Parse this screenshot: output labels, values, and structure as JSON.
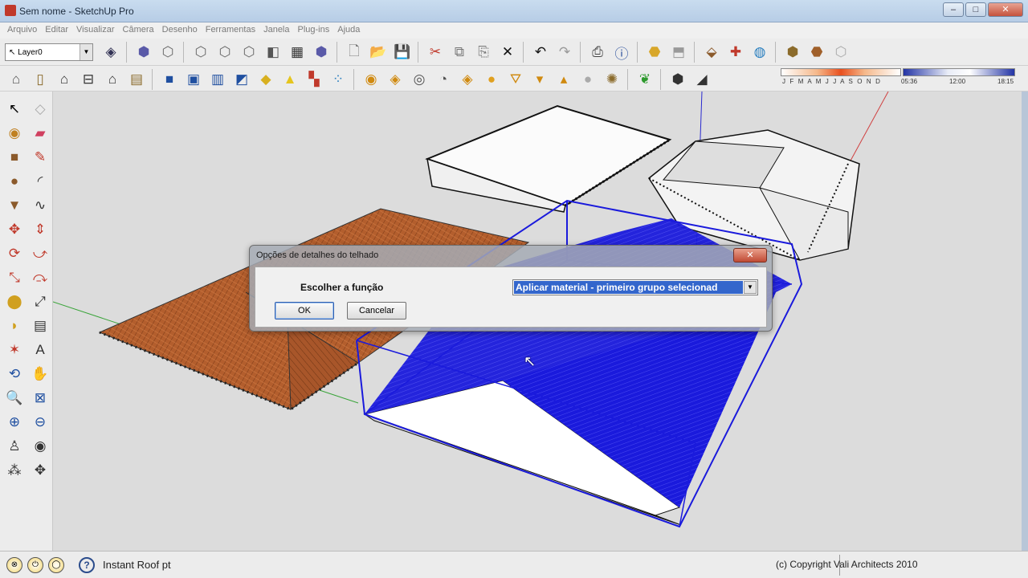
{
  "window": {
    "title": "Sem nome - SketchUp Pro",
    "controls": {
      "minimize": "–",
      "maximize": "□",
      "close": "✕"
    }
  },
  "menu": [
    "Arquivo",
    "Editar",
    "Visualizar",
    "Câmera",
    "Desenho",
    "Ferramentas",
    "Janela",
    "Plug-ins",
    "Ajuda"
  ],
  "layer": {
    "value": "Layer0"
  },
  "shadow_settings": {
    "months": "J F M A M J J A S O N D",
    "time_start": "05:36",
    "time_mid": "12:00",
    "time_end": "18:15"
  },
  "toolbar1_icons": [
    "select-icon",
    "component-icon",
    "iso-view-icon",
    "top-view-icon",
    "front-view-icon",
    "right-view-icon",
    "back-view-icon",
    "left-view-icon",
    "new-icon",
    "open-icon",
    "save-icon",
    "cut-icon",
    "copy-icon",
    "paste-icon",
    "erase-icon",
    "undo-icon",
    "redo-icon",
    "print-icon",
    "model-info-icon",
    "warehouse-icon",
    "share-icon",
    "component-share-icon",
    "extension-icon",
    "photo-texture-icon",
    "geo-location-icon",
    "terrain-icon",
    "toggle-terrain-icon"
  ],
  "toolbar2_icons": [
    "xray-icon",
    "wireframe-icon",
    "hidden-line-icon",
    "shaded-icon",
    "shaded-textures-icon",
    "monochrome-icon",
    "section-plane-icon",
    "section-display-icon",
    "section-cut-icon",
    "sandbox-icon",
    "fog-icon",
    "shadow-icon",
    "dimension-icon",
    "text-icon",
    "axes-icon",
    "protractor-icon",
    "tape-icon",
    "orbit-icon",
    "pan-icon",
    "zoom-icon",
    "camera-icon",
    "walk-icon",
    "lookaround-icon",
    "roof-icon",
    "shadows-toggle-icon",
    "sun-icon"
  ],
  "left_tools": [
    "select-icon",
    "eraser-icon",
    "paint-bucket-icon",
    "eraser-alt-icon",
    "rectangle-icon",
    "pencil-icon",
    "circle-icon",
    "arc-icon",
    "polygon-icon",
    "freehand-icon",
    "move-icon",
    "push-pull-icon",
    "rotate-icon",
    "follow-me-icon",
    "scale-icon",
    "offset-icon",
    "tape-measure-icon",
    "dimension-icon",
    "protractor-icon",
    "text-icon",
    "axes-icon",
    "3d-text-icon",
    "orbit-icon",
    "pan-icon",
    "zoom-icon",
    "zoom-window-icon",
    "zoom-extents-icon",
    "previous-view-icon",
    "position-camera-icon",
    "look-around-icon",
    "walk-icon",
    "section-plane-icon"
  ],
  "dialog": {
    "title": "Opções de detalhes do telhado",
    "close_label": "✕",
    "label": "Escolher a função",
    "selected": "Aplicar material - primeiro grupo selecionad",
    "ok": "OK",
    "cancel": "Cancelar"
  },
  "status": {
    "text": "Instant Roof pt",
    "copyright": "(c) Copyright  Vali Architects 2010",
    "help_label": "?",
    "circle_labels": [
      "⊗",
      "⏻",
      "◯"
    ]
  },
  "colors": {
    "roof_tile": "#b35e2d",
    "selection_blue": "#1a1adc",
    "viewport_bg": "#dcdcdc"
  }
}
